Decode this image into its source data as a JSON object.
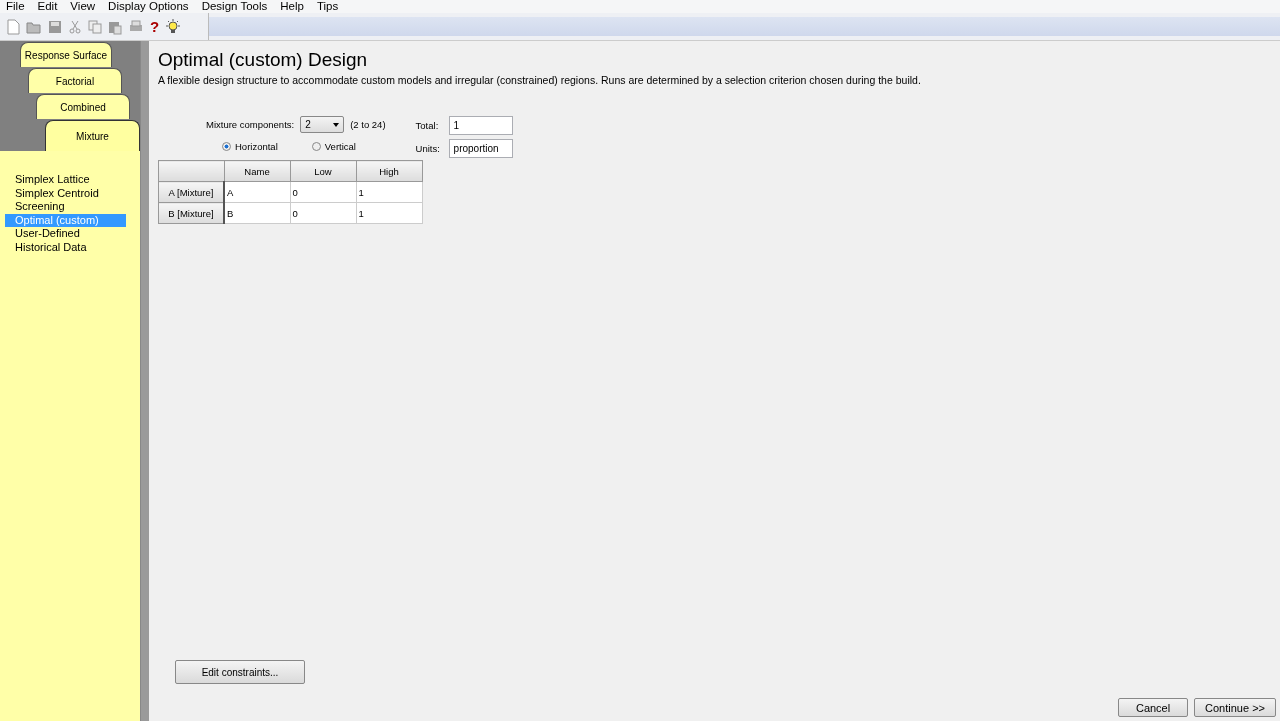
{
  "menu": [
    "File",
    "Edit",
    "View",
    "Display Options",
    "Design Tools",
    "Help",
    "Tips"
  ],
  "toolbar": {
    "help_glyph": "?"
  },
  "design_tabs": [
    {
      "label": "Response Surface",
      "selected": false
    },
    {
      "label": "Factorial",
      "selected": false
    },
    {
      "label": "Combined",
      "selected": false
    },
    {
      "label": "Mixture",
      "selected": true
    }
  ],
  "design_types": [
    {
      "label": "Simplex Lattice",
      "selected": false
    },
    {
      "label": "Simplex Centroid",
      "selected": false
    },
    {
      "label": "Screening",
      "selected": false
    },
    {
      "label": "Optimal (custom)",
      "selected": true
    },
    {
      "label": "User-Defined",
      "selected": false
    },
    {
      "label": "Historical Data",
      "selected": false
    }
  ],
  "title": "Optimal (custom) Design",
  "description": "A flexible design structure to accommodate custom models and irregular (constrained) regions.  Runs are determined by a selection criterion chosen during the build.",
  "components": {
    "label": "Mixture components:",
    "value": "2",
    "range": "(2 to 24)"
  },
  "orientation": [
    {
      "label": "Horizontal",
      "selected": true
    },
    {
      "label": "Vertical",
      "selected": false
    }
  ],
  "total": {
    "label": "Total:",
    "value": "1"
  },
  "units": {
    "label": "Units:",
    "value": "proportion"
  },
  "table": {
    "columns": [
      "Name",
      "Low",
      "High"
    ],
    "rows": [
      {
        "header": "A [Mixture]",
        "cells": [
          "A",
          "0",
          "1"
        ]
      },
      {
        "header": "B [Mixture]",
        "cells": [
          "B",
          "0",
          "1"
        ]
      }
    ]
  },
  "edit_button": "Edit constraints...",
  "buttons": [
    "Cancel",
    "Continue >>"
  ]
}
